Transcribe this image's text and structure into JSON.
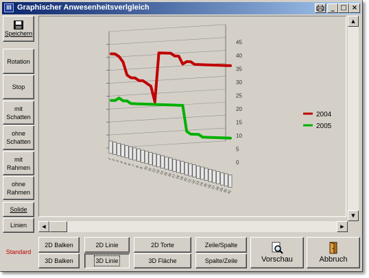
{
  "window": {
    "title": "Graphischer Anwesenheitsverlgleich",
    "icon_glyph": "III"
  },
  "titlebar_buttons": {
    "print": "print-icon",
    "minimize": "_",
    "maximize": "□",
    "close": "×"
  },
  "sidebar": {
    "save": {
      "label": "Speichern",
      "icon": "floppy-icon"
    },
    "rotation": "Rotation",
    "stop": "Stop",
    "mit_schatten": [
      "mit",
      "Schatten"
    ],
    "ohne_schatten": [
      "ohne",
      "Schatten"
    ],
    "mit_rahmen": [
      "mit",
      "Rahmen"
    ],
    "ohne_rahmen": [
      "ohne",
      "Rahmen"
    ],
    "solide": "Solide",
    "linien": "Linien",
    "standard": "Standard"
  },
  "bottom": {
    "balken_2d": "2D Balken",
    "balken_3d": "3D Balken",
    "linie_2d": "2D Linie",
    "linie_3d": "3D Linie",
    "torte_2d": "2D Torte",
    "flaeche_3d": "3D Fläche",
    "zeile_spalte": "Zeile/Spalte",
    "spalte_zeile": "Spalte/Zeile",
    "vorschau": "Vorschau",
    "abbruch": "Abbruch"
  },
  "colors": {
    "series_2004": "#c00000",
    "series_2005": "#00b000",
    "title_gradient_start": "#0a246a",
    "title_gradient_end": "#a6caf0"
  },
  "chart_data": {
    "type": "line",
    "title": "",
    "xlabel": "",
    "ylabel": "",
    "projection": "3d",
    "ylim": [
      0,
      40
    ],
    "right_ticks": [
      "0",
      "5",
      "10",
      "15",
      "20",
      "25",
      "30",
      "35",
      "40",
      "45"
    ],
    "x_count": 31,
    "legend_placement": "right",
    "series": [
      {
        "name": "2004",
        "color": "#c00000",
        "values": [
          43,
          43,
          42,
          40,
          35,
          34,
          34,
          33,
          33,
          32,
          31,
          25,
          44,
          44,
          44,
          44,
          43,
          43,
          40,
          41,
          41,
          40,
          40,
          40,
          40,
          40,
          40,
          40,
          40,
          40,
          40
        ]
      },
      {
        "name": "2005",
        "color": "#00b000",
        "values": [
          25,
          25,
          26,
          25,
          25,
          24,
          24,
          24,
          24,
          24,
          24,
          24,
          24,
          24,
          24,
          24,
          24,
          24,
          24,
          14,
          13,
          13,
          13,
          12,
          12,
          12,
          12,
          12,
          12,
          12,
          12
        ]
      }
    ]
  }
}
